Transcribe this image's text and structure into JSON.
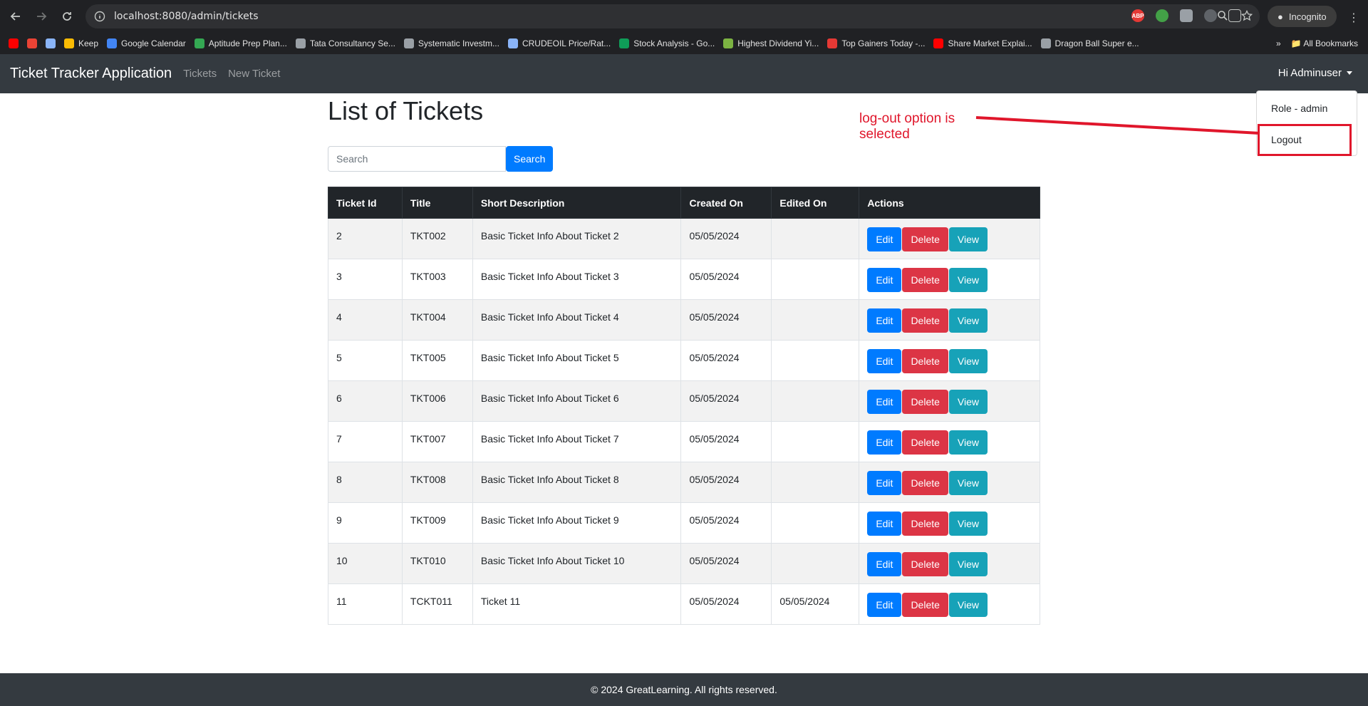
{
  "browser": {
    "url_host": "localhost:8080/admin/tickets",
    "incognito_label": "Incognito",
    "bookmarks": [
      {
        "label": "",
        "color": "#ff0000"
      },
      {
        "label": "",
        "color": "#ea4335"
      },
      {
        "label": "",
        "color": "#8ab4f8"
      },
      {
        "label": "Keep",
        "color": "#fbbc04"
      },
      {
        "label": "Google Calendar",
        "color": "#4285f4"
      },
      {
        "label": "Aptitude Prep Plan...",
        "color": "#34a853"
      },
      {
        "label": "Tata Consultancy Se...",
        "color": "#9aa0a6"
      },
      {
        "label": "Systematic Investm...",
        "color": "#9aa0a6"
      },
      {
        "label": "CRUDEOIL Price/Rat...",
        "color": "#8ab4f8"
      },
      {
        "label": "Stock Analysis - Go...",
        "color": "#0f9d58"
      },
      {
        "label": "Highest Dividend Yi...",
        "color": "#7cb342"
      },
      {
        "label": "Top Gainers Today -...",
        "color": "#e53935"
      },
      {
        "label": "Share Market Explai...",
        "color": "#ff0000"
      },
      {
        "label": "Dragon Ball Super e...",
        "color": "#9aa0a6"
      }
    ],
    "all_bookmarks_label": "All Bookmarks"
  },
  "navbar": {
    "brand": "Ticket Tracker Application",
    "links": [
      "Tickets",
      "New Ticket"
    ],
    "user_label": "Hi Adminuser"
  },
  "dropdown": {
    "role_label": "Role - admin",
    "logout_label": "Logout"
  },
  "annotation": {
    "line1": "log-out option is",
    "line2": "selected",
    "color": "#e0162b"
  },
  "main": {
    "title": "List of Tickets",
    "search_placeholder": "Search",
    "search_button": "Search",
    "columns": [
      "Ticket Id",
      "Title",
      "Short Description",
      "Created On",
      "Edited On",
      "Actions"
    ],
    "action_labels": {
      "edit": "Edit",
      "delete": "Delete",
      "view": "View"
    },
    "rows": [
      {
        "id": "2",
        "title": "TKT002",
        "desc": "Basic Ticket Info About Ticket 2",
        "created": "05/05/2024",
        "edited": ""
      },
      {
        "id": "3",
        "title": "TKT003",
        "desc": "Basic Ticket Info About Ticket 3",
        "created": "05/05/2024",
        "edited": ""
      },
      {
        "id": "4",
        "title": "TKT004",
        "desc": "Basic Ticket Info About Ticket 4",
        "created": "05/05/2024",
        "edited": ""
      },
      {
        "id": "5",
        "title": "TKT005",
        "desc": "Basic Ticket Info About Ticket 5",
        "created": "05/05/2024",
        "edited": ""
      },
      {
        "id": "6",
        "title": "TKT006",
        "desc": "Basic Ticket Info About Ticket 6",
        "created": "05/05/2024",
        "edited": ""
      },
      {
        "id": "7",
        "title": "TKT007",
        "desc": "Basic Ticket Info About Ticket 7",
        "created": "05/05/2024",
        "edited": ""
      },
      {
        "id": "8",
        "title": "TKT008",
        "desc": "Basic Ticket Info About Ticket 8",
        "created": "05/05/2024",
        "edited": ""
      },
      {
        "id": "9",
        "title": "TKT009",
        "desc": "Basic Ticket Info About Ticket 9",
        "created": "05/05/2024",
        "edited": ""
      },
      {
        "id": "10",
        "title": "TKT010",
        "desc": "Basic Ticket Info About Ticket 10",
        "created": "05/05/2024",
        "edited": ""
      },
      {
        "id": "11",
        "title": "TCKT011",
        "desc": "Ticket 11",
        "created": "05/05/2024",
        "edited": "05/05/2024"
      }
    ]
  },
  "footer": {
    "text": "© 2024 GreatLearning. All rights reserved."
  },
  "colors": {
    "primary": "#007bff",
    "danger": "#dc3545",
    "info": "#17a2b8",
    "navbar": "#343a40"
  }
}
